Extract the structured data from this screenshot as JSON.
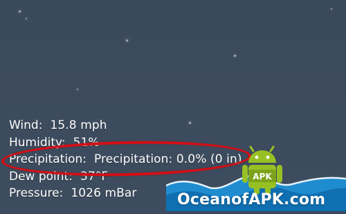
{
  "weather": {
    "rows": [
      {
        "label": "Wind:",
        "value": "15.8 mph"
      },
      {
        "label": "Humidity:",
        "value": "51%"
      },
      {
        "label": "Precipitation:",
        "value": "Precipitation: 0.0% (0 in)"
      },
      {
        "label": "Dew point:",
        "value": "37°F"
      },
      {
        "label": "Pressure:",
        "value": "1026 mBar"
      }
    ]
  },
  "watermark": {
    "site": "OceanofAPK.com",
    "badge": "APK"
  },
  "colors": {
    "background": "#3b4a5c",
    "text": "#ffffff",
    "highlight": "#d50f16",
    "android_green": "#97c024",
    "wave_blue": "#1f8fd6"
  }
}
